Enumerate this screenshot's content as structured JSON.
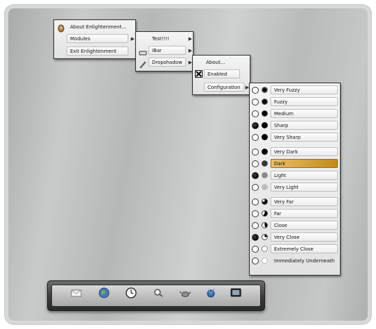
{
  "main_menu": {
    "items": [
      {
        "label": "About Enlightenment..."
      },
      {
        "label": "Modules"
      },
      {
        "label": "Exit Enlightenment"
      }
    ]
  },
  "modules_menu": {
    "items": [
      {
        "label": "Test!!!!"
      },
      {
        "label": "IBar"
      },
      {
        "label": "Dropshadow"
      }
    ]
  },
  "dropshadow_menu": {
    "items": [
      {
        "label": "About..."
      },
      {
        "label": "Enabled",
        "checked": true
      },
      {
        "label": "Configuration"
      }
    ]
  },
  "configuration_menu": {
    "groups": [
      {
        "items": [
          {
            "label": "Very Fuzzy",
            "selected": false
          },
          {
            "label": "Fuzzy",
            "selected": false
          },
          {
            "label": "Medium",
            "selected": false
          },
          {
            "label": "Sharp",
            "selected": true
          },
          {
            "label": "Very Sharp",
            "selected": false
          }
        ]
      },
      {
        "items": [
          {
            "label": "Very Dark",
            "selected": false
          },
          {
            "label": "Dark",
            "selected": false,
            "highlighted": true
          },
          {
            "label": "Light",
            "selected": true
          },
          {
            "label": "Very Light",
            "selected": false
          }
        ]
      },
      {
        "items": [
          {
            "label": "Very Far",
            "selected": false
          },
          {
            "label": "Far",
            "selected": false
          },
          {
            "label": "Close",
            "selected": false
          },
          {
            "label": "Very Close",
            "selected": true
          },
          {
            "label": "Extremely Close",
            "selected": false
          },
          {
            "label": "Immediately Underneath",
            "selected": false
          }
        ]
      }
    ]
  },
  "shelf": {
    "icons": [
      "envelope-icon",
      "globe-icon",
      "clock-icon",
      "magnifier-icon",
      "teapot-icon",
      "network-icon",
      "monitor-icon"
    ]
  },
  "colors": {
    "highlight": "#d9a232",
    "menu_bg": "#ececec",
    "shelf_bg": "#3b3b3b"
  }
}
